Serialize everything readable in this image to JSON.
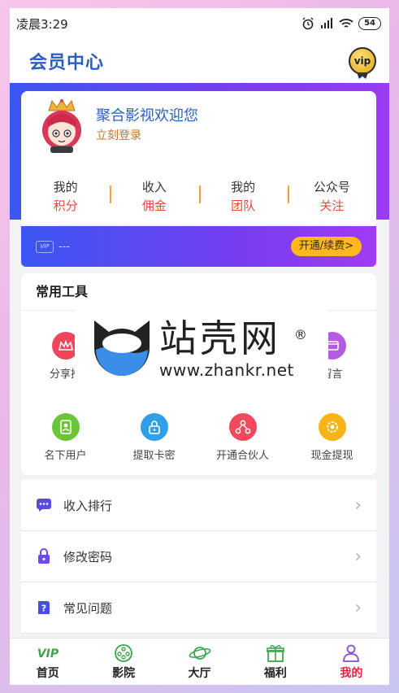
{
  "status_bar": {
    "time": "凌晨3:29",
    "battery": "54"
  },
  "header": {
    "title": "会员中心",
    "vip_badge": "vip"
  },
  "profile": {
    "username": "聚合影视欢迎您",
    "login_label": "立刻登录",
    "stats": [
      {
        "top": "我的",
        "bottom": "积分"
      },
      {
        "top": "收入",
        "bottom": "佣金"
      },
      {
        "top": "我的",
        "bottom": "团队"
      },
      {
        "top": "公众号",
        "bottom": "关注"
      }
    ]
  },
  "vip_bar": {
    "chip": "VIP",
    "card_text": "---",
    "renew_label": "开通/续费>"
  },
  "tools": {
    "title": "常用工具",
    "items": [
      {
        "label": "分享推",
        "color": "#f0455a",
        "icon": "crown-icon"
      },
      {
        "label": "",
        "color": "#ffffff",
        "icon": "hidden"
      },
      {
        "label": "",
        "color": "#ffffff",
        "icon": "hidden"
      },
      {
        "label": "留言",
        "color": "#b35ce0",
        "icon": "message-icon"
      },
      {
        "label": "名下用户",
        "color": "#6cc43a",
        "icon": "user-card-icon"
      },
      {
        "label": "提取卡密",
        "color": "#2f9fe8",
        "icon": "lock-icon"
      },
      {
        "label": "开通合伙人",
        "color": "#f04a5c",
        "icon": "network-icon"
      },
      {
        "label": "现金提现",
        "color": "#f7b416",
        "icon": "gear-coin-icon"
      }
    ]
  },
  "watermark": {
    "name": "站壳网",
    "reg": "®",
    "url": "www.zhankr.net"
  },
  "menu": [
    {
      "label": "收入排行",
      "color": "#5a4be0",
      "icon": "chat-icon"
    },
    {
      "label": "修改密码",
      "color": "#6a4be8",
      "icon": "padlock-icon"
    },
    {
      "label": "常见问题",
      "color": "#4a4ee0",
      "icon": "question-icon"
    }
  ],
  "tabbar": [
    {
      "label": "首页",
      "icon": "vip-icon"
    },
    {
      "label": "影院",
      "icon": "film-reel-icon"
    },
    {
      "label": "大厅",
      "icon": "planet-icon"
    },
    {
      "label": "福利",
      "icon": "gift-icon"
    },
    {
      "label": "我的",
      "icon": "person-icon",
      "active": true
    }
  ]
}
